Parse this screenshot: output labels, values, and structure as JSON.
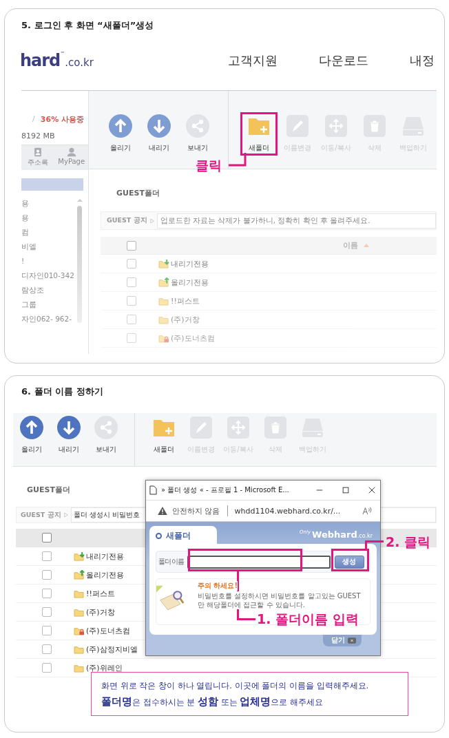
{
  "step5": {
    "title": "5. 로그인 후 화면 “새폴더”생성",
    "logo": {
      "name": "hard",
      "mark": "™",
      "domain": ".co.kr"
    },
    "nav": [
      "고객지원",
      "다운로드",
      "내정"
    ],
    "usage": {
      "divider": "/",
      "percent": "36% 사용중",
      "capacity": "8192 MB"
    },
    "shortcuts": [
      {
        "kind": "address-book",
        "label": "주소록"
      },
      {
        "kind": "person",
        "label": "MyPage"
      }
    ],
    "sidebar_items": [
      "용",
      "용",
      "컴",
      "비엘",
      "!",
      "디자인010-342",
      "람상조",
      "그룹",
      "자인062- 962-"
    ],
    "toolbar": [
      {
        "kind": "upload",
        "label": "올리기",
        "disabled": false,
        "highlighted": false
      },
      {
        "kind": "download",
        "label": "내리기",
        "disabled": false,
        "highlighted": false
      },
      {
        "kind": "share",
        "label": "보내기",
        "disabled": false,
        "highlighted": false
      },
      {
        "kind": "new-folder",
        "label": "새폴더",
        "disabled": false,
        "highlighted": true
      },
      {
        "kind": "rename",
        "label": "이름변경",
        "disabled": true,
        "highlighted": false
      },
      {
        "kind": "move",
        "label": "이동/복사",
        "disabled": true,
        "highlighted": false
      },
      {
        "kind": "delete",
        "label": "삭제",
        "disabled": true,
        "highlighted": false
      },
      {
        "kind": "backup",
        "label": "백업하기",
        "disabled": true,
        "highlighted": false
      }
    ],
    "callout": "클릭",
    "folder_title": "GUEST폴더",
    "notice": {
      "label": "GUEST 공지",
      "text": "업로드한 자료는 삭제가 불가하니, 정확히 확인 후 올려주세요."
    },
    "select_all": {
      "checked": false
    },
    "column": "이름",
    "rows": [
      {
        "kind": "download",
        "name": "내리기전용",
        "checked": false
      },
      {
        "kind": "upload",
        "name": "올리기전용",
        "checked": false
      },
      {
        "kind": "plain",
        "name": "!!퍼스트",
        "checked": false
      },
      {
        "kind": "plain",
        "name": "(주)거창",
        "checked": false
      },
      {
        "kind": "locked",
        "name": "(주)도너츠컴",
        "checked": false
      }
    ]
  },
  "step6": {
    "title": "6. 폴더 이름 정하기",
    "toolbar": [
      {
        "kind": "upload",
        "label": "올리기",
        "disabled": false
      },
      {
        "kind": "download",
        "label": "내리기",
        "disabled": false
      },
      {
        "kind": "share",
        "label": "보내기",
        "disabled": false
      },
      {
        "kind": "new-folder",
        "label": "새폴더",
        "disabled": false
      },
      {
        "kind": "rename",
        "label": "이름변경",
        "disabled": true
      },
      {
        "kind": "move",
        "label": "이동/복사",
        "disabled": true
      },
      {
        "kind": "delete",
        "label": "삭제",
        "disabled": true
      },
      {
        "kind": "backup",
        "label": "백업하기",
        "disabled": true
      }
    ],
    "folder_title": "GUEST폴더",
    "notice": {
      "label": "GUEST 공지",
      "text": "폴더 생성시 비밀번호"
    },
    "select_all": {
      "checked": false
    },
    "rows": [
      {
        "kind": "download",
        "name": "내리기전용",
        "checked": false
      },
      {
        "kind": "upload",
        "name": "올리기전용",
        "checked": false
      },
      {
        "kind": "plain",
        "name": "!!퍼스트",
        "checked": false
      },
      {
        "kind": "plain",
        "name": "(주)거창",
        "checked": false
      },
      {
        "kind": "locked",
        "name": "(주)도너츠컴",
        "checked": false
      },
      {
        "kind": "plain",
        "name": "(주)삼정지비엘",
        "checked": false
      },
      {
        "kind": "plain",
        "name": "(주)위레인",
        "checked": false
      }
    ],
    "popup": {
      "title": "» 폴더 생성 « - 프로필 1 - Microsoft E...",
      "security": "안전하지 않음",
      "url": "whdd1104.webhard.co.kr/...",
      "tab": "새폴더",
      "brand_small": "Only",
      "brand": "Webhard",
      "brand_suffix": ".co.kr",
      "field_label": "폴더이름",
      "create_button": "생성",
      "warning_title": "주의 하세요!",
      "warning_text": "비밀번호를 설정하시면 비밀번호를 알고있는 GUEST만 해당폴더에 접근할 수 있습니다.",
      "close_button": "닫기"
    },
    "callouts": [
      {
        "kind": "input",
        "text": "1. 폴더이름 입력"
      },
      {
        "kind": "button",
        "text": "2. 클릭"
      }
    ],
    "info": [
      "화면 위로 작은 창이 하나 열립니다. 이곳에 폴더의 이름을 입력해주세요.",
      "**폴더명**은 접수하시는 분 **성함** 또는 **업체명**으로 해주세요"
    ]
  }
}
